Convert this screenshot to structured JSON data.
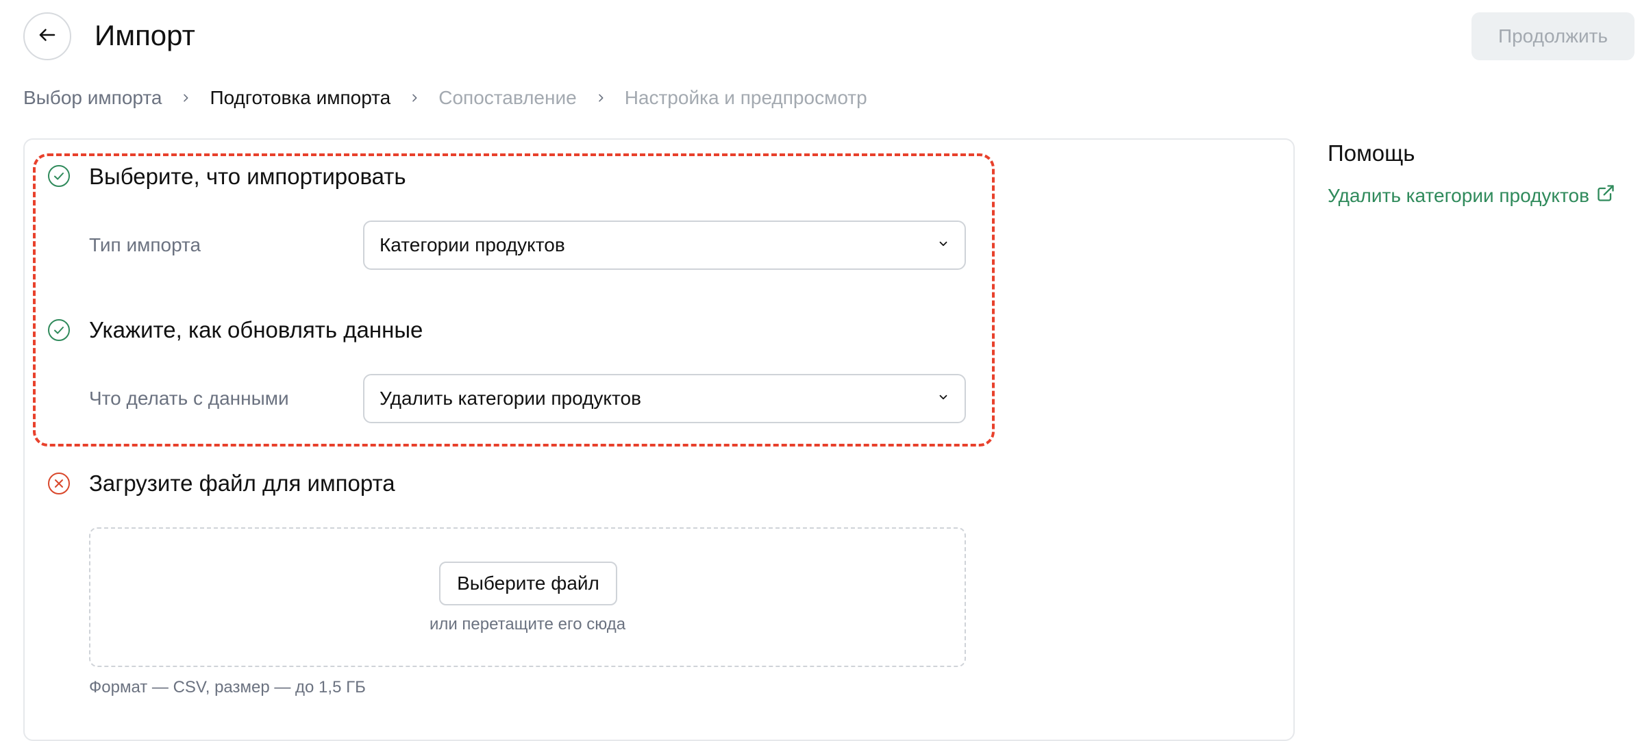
{
  "header": {
    "title": "Импорт",
    "continue_label": "Продолжить"
  },
  "breadcrumb": [
    {
      "label": "Выбор импорта",
      "state": "done"
    },
    {
      "label": "Подготовка импорта",
      "state": "current"
    },
    {
      "label": "Сопоставление",
      "state": "future"
    },
    {
      "label": "Настройка и предпросмотр",
      "state": "future"
    }
  ],
  "steps": {
    "choose": {
      "title": "Выберите, что импортировать",
      "status": "complete",
      "field_label": "Тип импорта",
      "value": "Категории продуктов"
    },
    "update": {
      "title": "Укажите, как обновлять данные",
      "status": "complete",
      "field_label": "Что делать с данными",
      "value": "Удалить категории продуктов"
    },
    "upload": {
      "title": "Загрузите файл для импорта",
      "status": "error",
      "button_label": "Выберите файл",
      "drop_hint": "или перетащите его сюда",
      "format_note": "Формат — CSV, размер — до 1,5 ГБ"
    }
  },
  "help": {
    "title": "Помощь",
    "link_label": "Удалить категории продуктов"
  },
  "colors": {
    "success": "#2f8a5b",
    "error": "#d9472b",
    "highlight": "#e8412c",
    "link": "#2f8a5b"
  },
  "icons": {
    "back": "arrow-left-icon",
    "complete": "check-circle-icon",
    "error": "x-circle-icon",
    "dropdown": "chevron-down-icon",
    "external": "external-link-icon",
    "separator": "chevron-right-icon"
  }
}
